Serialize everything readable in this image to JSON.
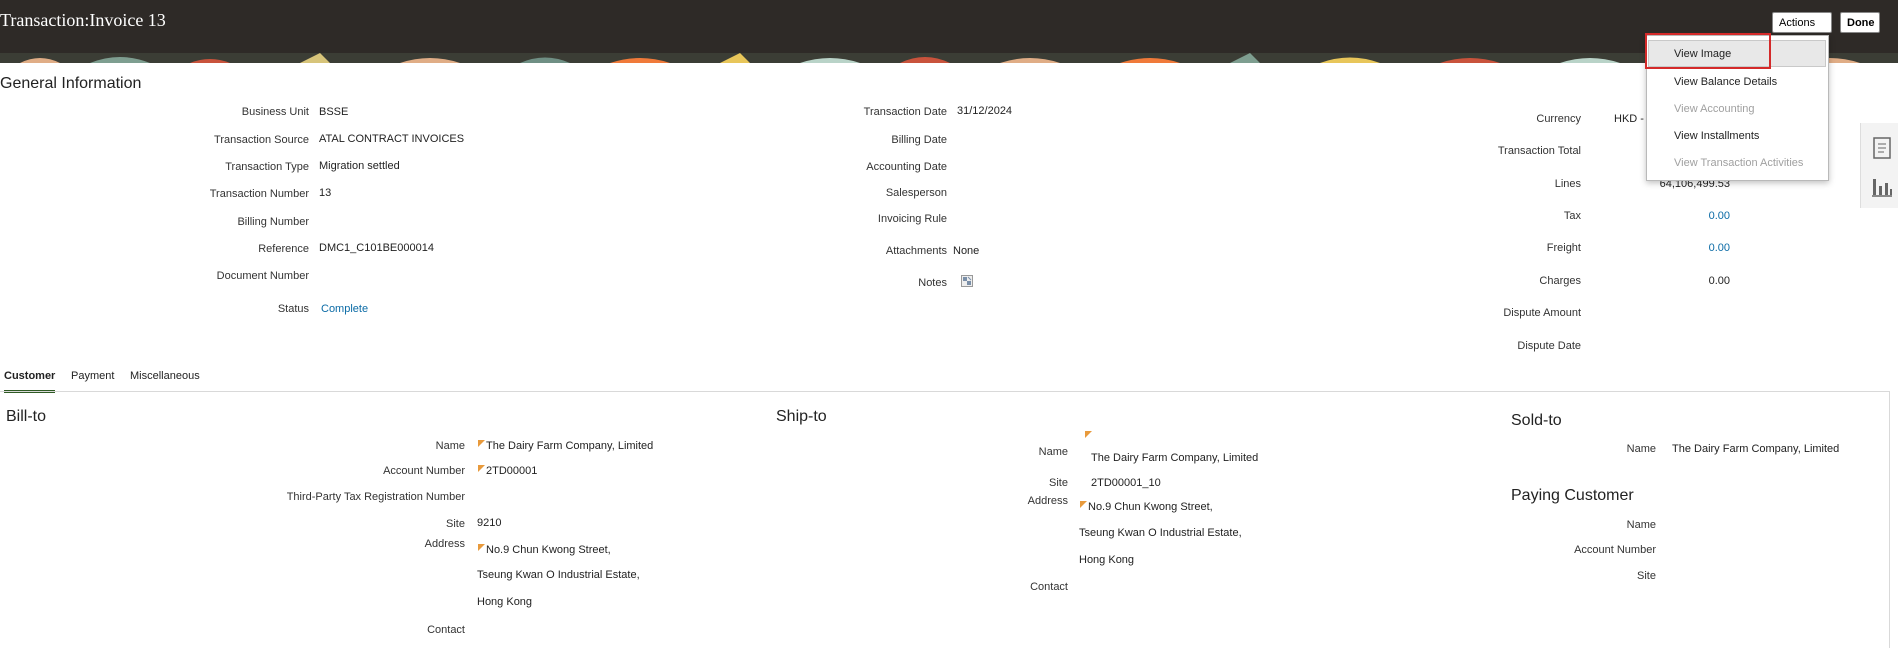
{
  "header": {
    "title": "Transaction:Invoice 13",
    "actions_label": "Actions",
    "done_label": "Done"
  },
  "actions_menu": {
    "items": [
      {
        "label": "View Image",
        "enabled": true
      },
      {
        "label": "View Balance Details",
        "enabled": true
      },
      {
        "label": "View Accounting",
        "enabled": false
      },
      {
        "label": "View Installments",
        "enabled": true
      },
      {
        "label": "View Transaction Activities",
        "enabled": false
      }
    ]
  },
  "general": {
    "heading": "General Information",
    "col1": [
      {
        "label": "Business Unit",
        "value": "BSSE"
      },
      {
        "label": "Transaction Source",
        "value": "ATAL CONTRACT INVOICES"
      },
      {
        "label": "Transaction Type",
        "value": "Migration settled"
      },
      {
        "label": "Transaction Number",
        "value": "13"
      },
      {
        "label": "Billing Number",
        "value": ""
      },
      {
        "label": "Reference",
        "value": "DMC1_C101BE000014"
      },
      {
        "label": "Document Number",
        "value": ""
      },
      {
        "label": "Status",
        "value": "Complete"
      }
    ],
    "col2": [
      {
        "label": "Transaction Date",
        "value": "31/12/2024"
      },
      {
        "label": "Billing Date",
        "value": ""
      },
      {
        "label": "Accounting Date",
        "value": ""
      },
      {
        "label": "Salesperson",
        "value": ""
      },
      {
        "label": "Invoicing Rule",
        "value": ""
      },
      {
        "label": "Attachments",
        "value": "None"
      },
      {
        "label": "Notes",
        "value": ""
      }
    ],
    "col3": [
      {
        "label": "Currency",
        "value": "HKD -"
      },
      {
        "label": "Transaction Total",
        "value": ""
      },
      {
        "label": "Lines",
        "value": "64,106,499.53"
      },
      {
        "label": "Tax",
        "value": "0.00"
      },
      {
        "label": "Freight",
        "value": "0.00"
      },
      {
        "label": "Charges",
        "value": "0.00"
      },
      {
        "label": "Dispute Amount",
        "value": ""
      },
      {
        "label": "Dispute Date",
        "value": ""
      }
    ]
  },
  "tabs": [
    "Customer",
    "Payment",
    "Miscellaneous"
  ],
  "bill_to": {
    "heading": "Bill-to",
    "name_label": "Name",
    "name": "The Dairy Farm Company, Limited",
    "account_label": "Account Number",
    "account": "2TD00001",
    "tax_label": "Third-Party Tax Registration Number",
    "site_label": "Site",
    "site": "9210",
    "address_label": "Address",
    "address": [
      "No.9 Chun Kwong Street,",
      "Tseung Kwan O Industrial Estate,",
      "Hong Kong"
    ],
    "contact_label": "Contact"
  },
  "ship_to": {
    "heading": "Ship-to",
    "name_label": "Name",
    "name": "The Dairy Farm Company, Limited",
    "site_label": "Site",
    "site": "2TD00001_10",
    "address_label": "Address",
    "address": [
      "No.9 Chun Kwong Street,",
      "Tseung Kwan O Industrial Estate,",
      "Hong Kong"
    ],
    "contact_label": "Contact"
  },
  "sold_to": {
    "heading": "Sold-to",
    "name_label": "Name",
    "name": "The Dairy Farm Company, Limited"
  },
  "paying_customer": {
    "heading": "Paying Customer",
    "name_label": "Name",
    "account_label": "Account Number",
    "site_label": "Site"
  }
}
